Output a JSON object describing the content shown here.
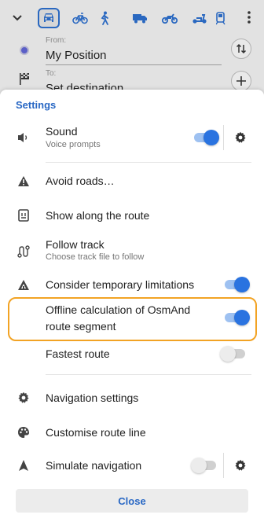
{
  "header": {
    "transport_modes": [
      "car-icon",
      "bicycle-icon",
      "pedestrian-icon",
      "truck-icon",
      "motorcycle-icon",
      "moped-icon",
      "public-transport-icon"
    ],
    "selected_mode": "car",
    "from_label": "From:",
    "from_value": "My Position",
    "to_label": "To:",
    "to_value": "Set destination"
  },
  "settings": {
    "title": "Settings",
    "sound": {
      "label": "Sound",
      "sub": "Voice prompts",
      "on": true
    },
    "avoid_roads": "Avoid roads…",
    "show_along": "Show along the route",
    "follow_track": {
      "label": "Follow track",
      "sub": "Choose track file to follow"
    },
    "temp_limits": {
      "label": "Consider temporary limitations",
      "on": true
    },
    "offline_calc": {
      "label_line1": "Offline calculation of OsmAnd",
      "label_line2": "route segment",
      "on": true
    },
    "fastest_route": {
      "label": "Fastest route",
      "on": false
    },
    "nav_settings": "Navigation settings",
    "customise_line": "Customise route line",
    "simulate": {
      "label": "Simulate navigation",
      "on": false
    },
    "close_label": "Close"
  },
  "colors": {
    "accent": "#2867c4",
    "toggle_on": "#2a73e0",
    "highlight": "#f2a324"
  }
}
